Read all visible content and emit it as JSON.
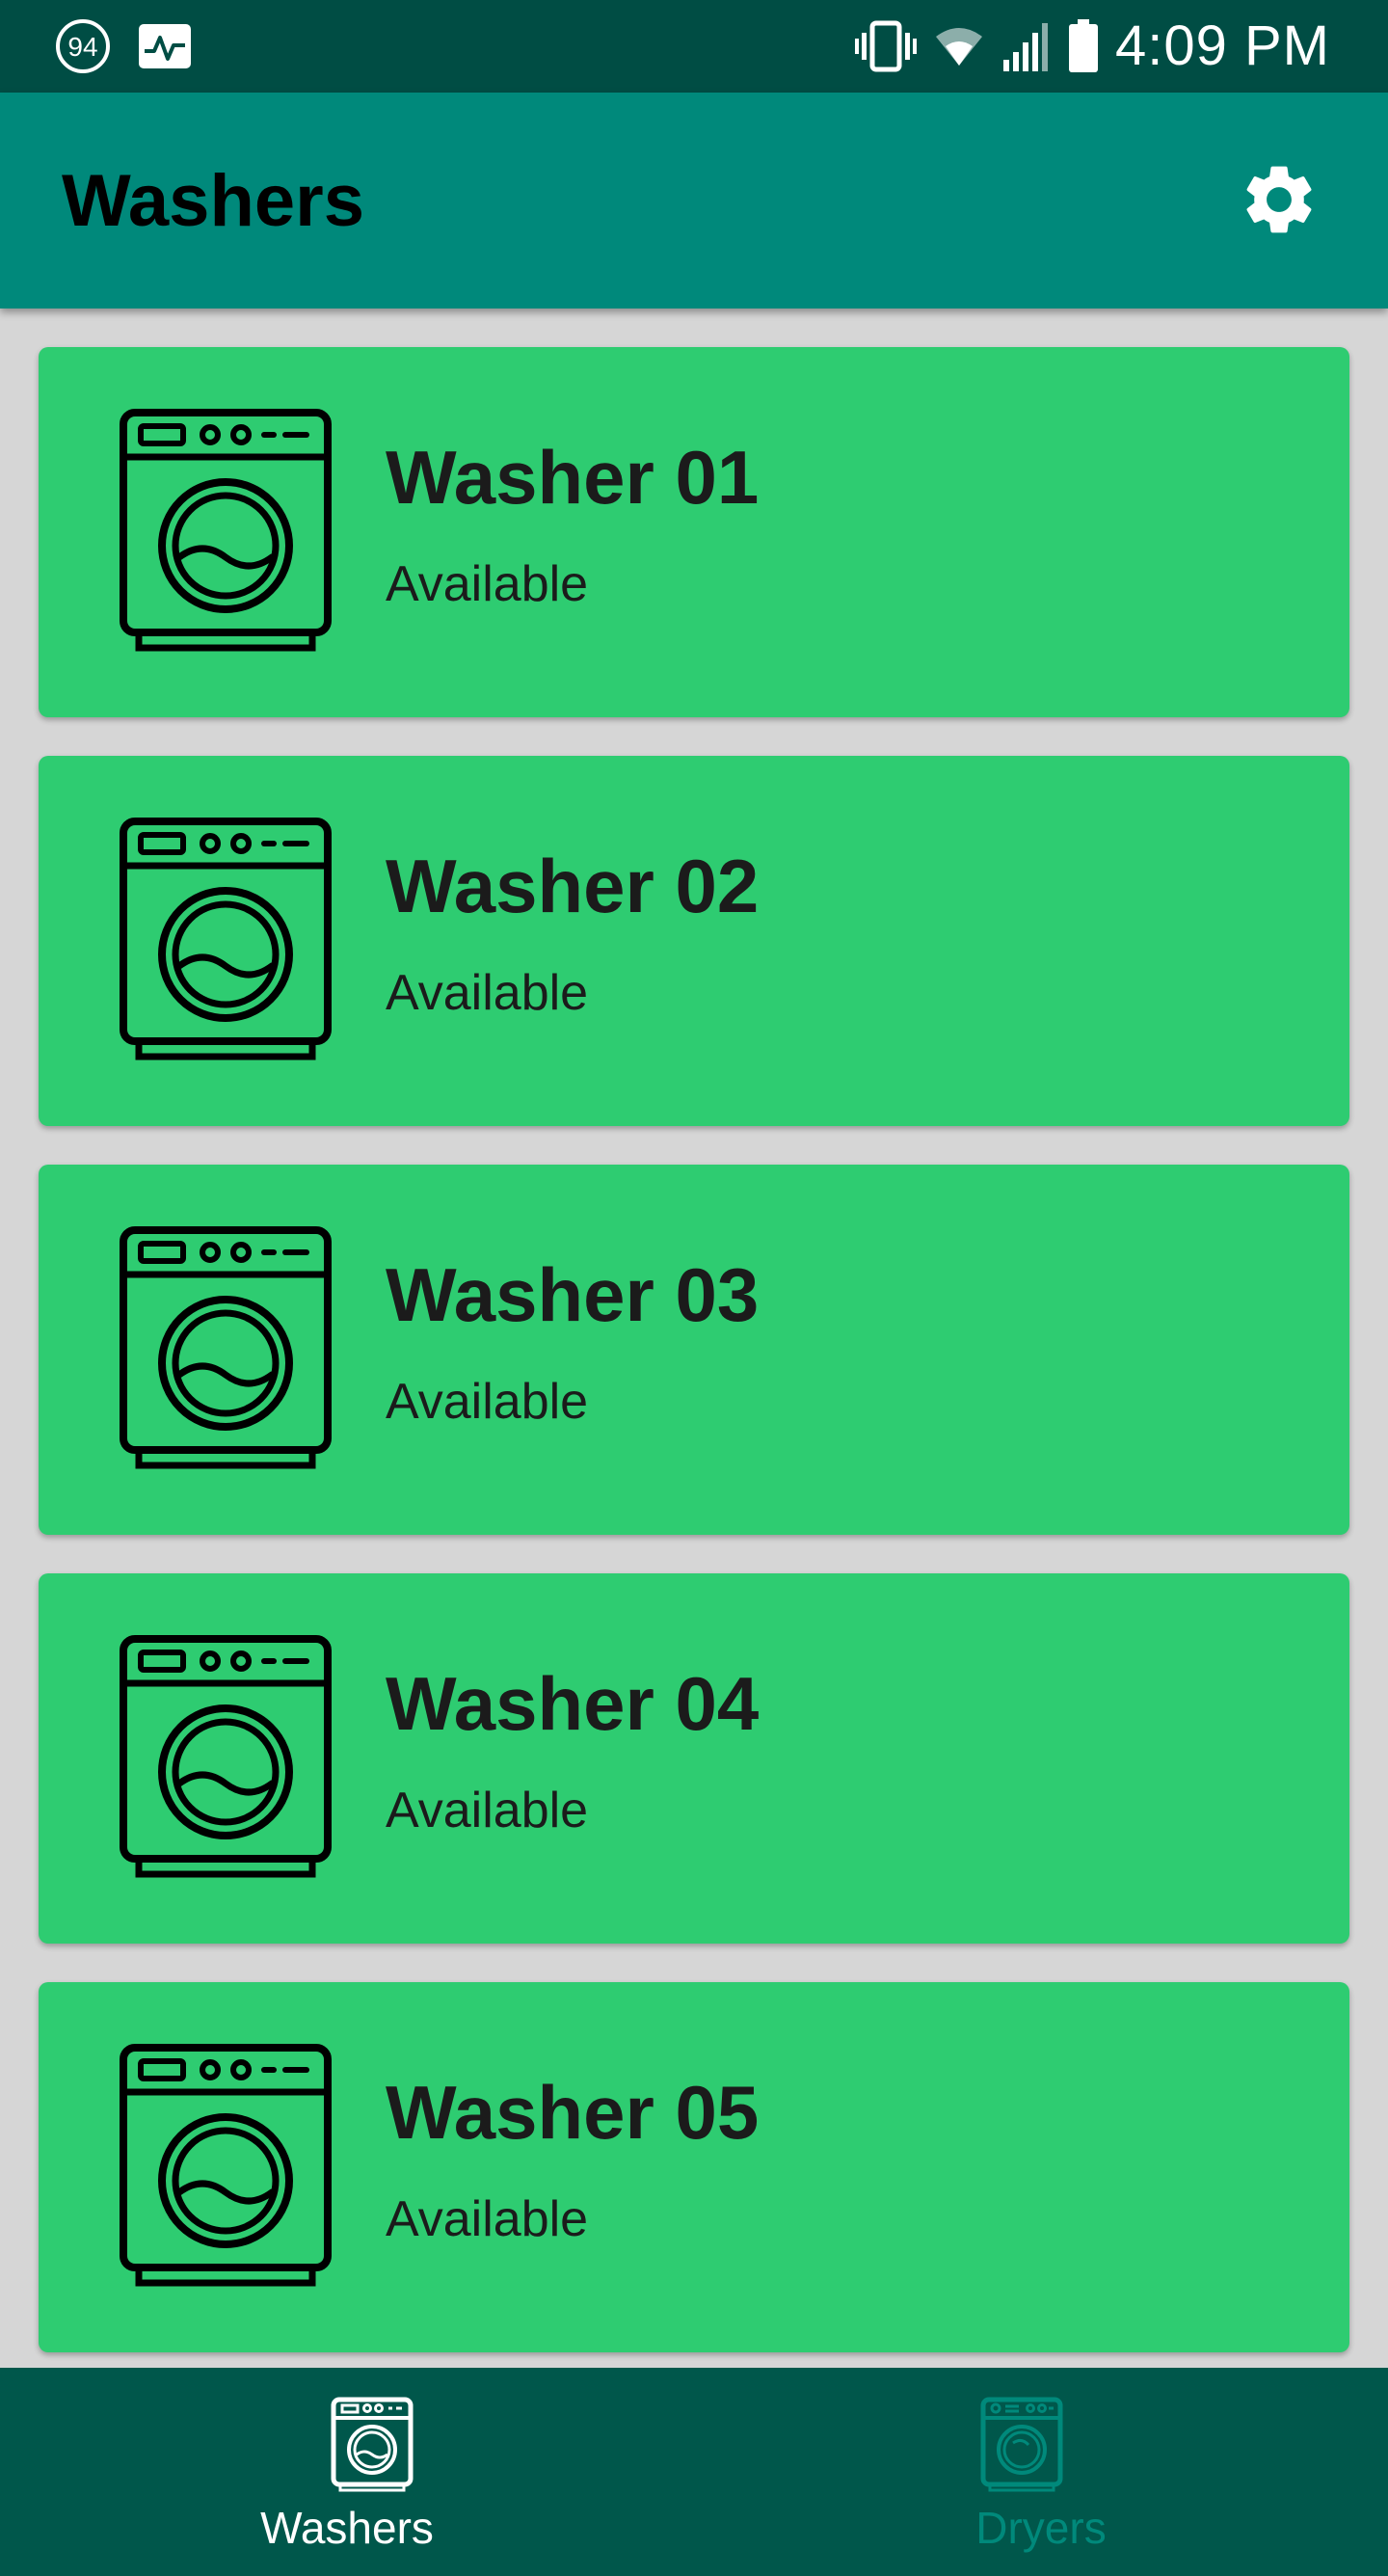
{
  "status_bar": {
    "notification_badge": "94",
    "time": "4:09 PM",
    "icons": [
      "notification-count-icon",
      "activity-monitor-icon",
      "vibrate-icon",
      "wifi-icon",
      "cell-signal-icon",
      "battery-icon"
    ]
  },
  "app_bar": {
    "title": "Washers",
    "action_icon": "gear-icon"
  },
  "machines": [
    {
      "name": "Washer 01",
      "status": "Available"
    },
    {
      "name": "Washer 02",
      "status": "Available"
    },
    {
      "name": "Washer 03",
      "status": "Available"
    },
    {
      "name": "Washer 04",
      "status": "Available"
    },
    {
      "name": "Washer 05",
      "status": "Available"
    }
  ],
  "bottom_nav": {
    "items": [
      {
        "label": "Washers",
        "icon": "washer-icon",
        "selected": true
      },
      {
        "label": "Dryers",
        "icon": "dryer-icon",
        "selected": false
      }
    ]
  },
  "colors": {
    "status_bar": "#004d44",
    "app_bar": "#00897b",
    "card_available": "#2ecc71",
    "list_background": "#d6d6d6",
    "bottom_nav": "#00574b",
    "nav_inactive": "#00897b"
  }
}
